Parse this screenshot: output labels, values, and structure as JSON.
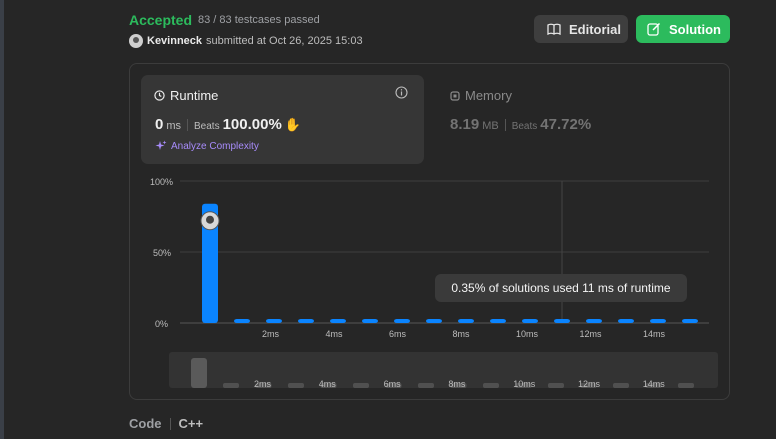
{
  "submission": {
    "status": "Accepted",
    "testcases": "83 / 83 testcases passed",
    "author": "Kevinneck",
    "submitted_at": "submitted at Oct 26, 2025 15:03"
  },
  "buttons": {
    "editorial": "Editorial",
    "solution": "Solution"
  },
  "runtime": {
    "title": "Runtime",
    "value": "0",
    "unit": "ms",
    "beats_label": "Beats",
    "beats": "100.00%",
    "analyze": "Analyze Complexity"
  },
  "memory": {
    "title": "Memory",
    "value": "8.19",
    "unit": "MB",
    "beats_label": "Beats",
    "beats": "47.72%"
  },
  "tooltip": "0.35% of solutions used 11 ms of runtime",
  "code": {
    "label": "Code",
    "language": "C++"
  },
  "colors": {
    "accent_green": "#2cbb5d",
    "bar_blue": "#0a84ff",
    "analyze_purple": "#a78bfa"
  },
  "chart_data": {
    "type": "bar",
    "title": "",
    "xlabel": "",
    "ylabel": "",
    "ylim": [
      0,
      100
    ],
    "ytick_labels": [
      "100%",
      "50%",
      "0%"
    ],
    "xtick_labels": [
      "2ms",
      "4ms",
      "6ms",
      "8ms",
      "10ms",
      "12ms",
      "14ms"
    ],
    "categories": [
      "0ms",
      "1ms",
      "2ms",
      "3ms",
      "4ms",
      "5ms",
      "6ms",
      "7ms",
      "8ms",
      "9ms",
      "10ms",
      "11ms",
      "12ms",
      "13ms",
      "14ms",
      "15ms"
    ],
    "values": [
      84,
      0.4,
      0.4,
      0.4,
      0.4,
      0.4,
      0.4,
      0.4,
      0.4,
      0.4,
      0.4,
      0.35,
      0.4,
      0.4,
      0.4,
      0.4
    ],
    "highlight_index": 11,
    "current_index": 0,
    "grid": true
  },
  "scrubber": {
    "xtick_labels": [
      "2ms",
      "4ms",
      "6ms",
      "8ms",
      "10ms",
      "12ms",
      "14ms"
    ]
  }
}
